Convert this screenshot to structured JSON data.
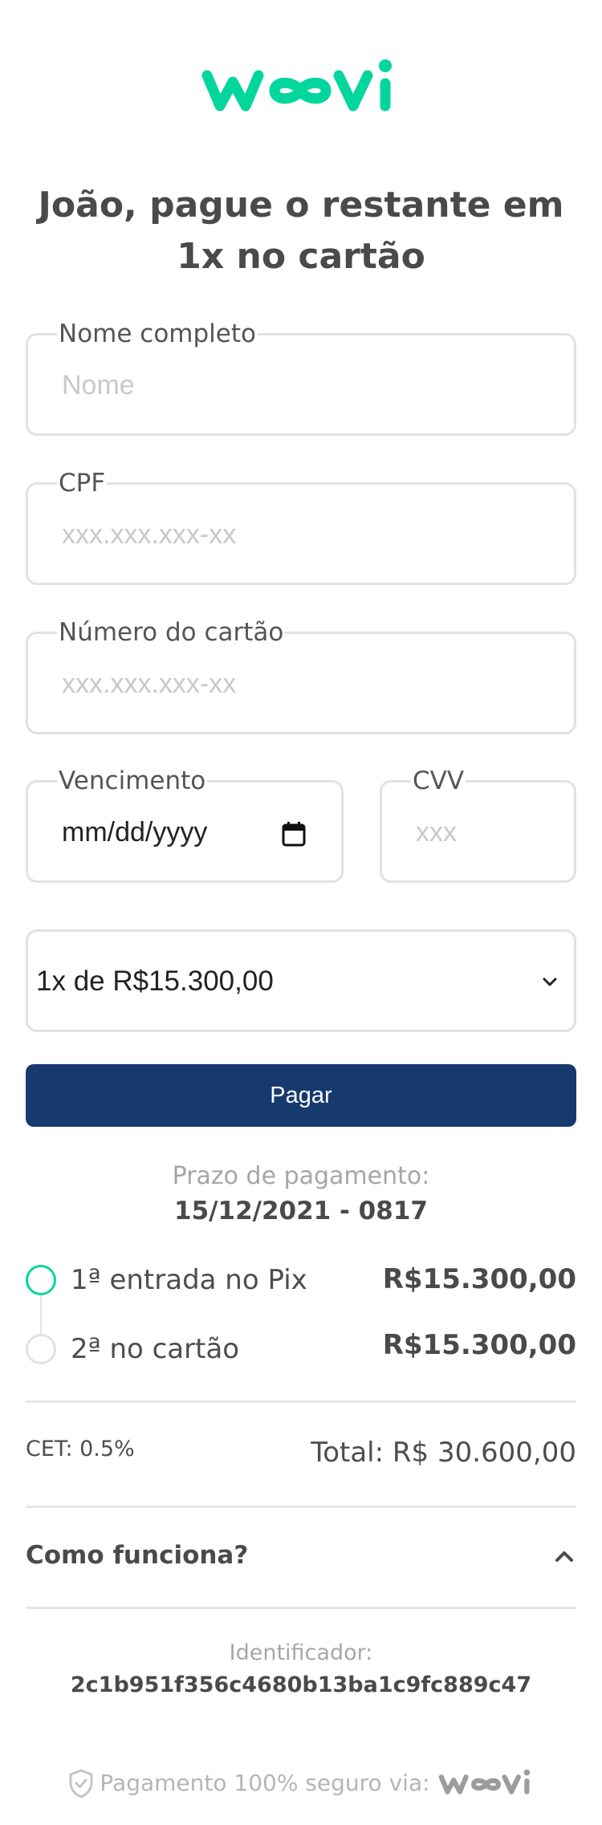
{
  "brand": {
    "logo_text": "woovi",
    "accent": "#03d69d",
    "primary": "#163a6e"
  },
  "title": "João, pague o restante em 1x no cartão",
  "form": {
    "name": {
      "label": "Nome completo",
      "placeholder": "Nome"
    },
    "cpf": {
      "label": "CPF",
      "placeholder": "xxx.xxx.xxx-xx"
    },
    "card": {
      "label": "Número do cartão",
      "placeholder": "xxx.xxx.xxx-xx"
    },
    "expiry": {
      "label": "Vencimento",
      "value": "mm/dd/yyyy"
    },
    "cvv": {
      "label": "CVV",
      "placeholder": "xxx"
    },
    "installments": {
      "selected": "1x de R$15.300,00"
    },
    "pay_label": "Pagar"
  },
  "deadline": {
    "label": "Prazo de pagamento:",
    "value": "15/12/2021 - 0817"
  },
  "steps": [
    {
      "label": "1ª entrada no Pix",
      "amount": "R$15.300,00",
      "status": "done"
    },
    {
      "label": "2ª no cartão",
      "amount": "R$15.300,00",
      "status": "pending"
    }
  ],
  "summary": {
    "cet": "CET: 0.5%",
    "total": "Total: R$ 30.600,00"
  },
  "faq": {
    "label": "Como funciona?"
  },
  "identifier": {
    "label": "Identificador:",
    "value": "2c1b951f356c4680b13ba1c9fc889c47"
  },
  "footer": {
    "text": "Pagamento 100% seguro via:"
  }
}
